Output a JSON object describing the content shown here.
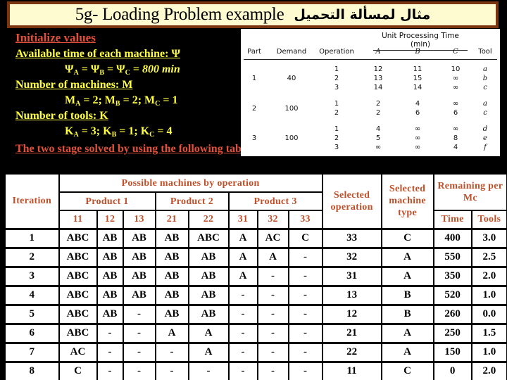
{
  "title": {
    "english": "5g- Loading Problem example",
    "arabic": "مثال لمسألة التحميل"
  },
  "intro": {
    "heading": "Initialize values",
    "available_time_label": "Available time of each machine: Ψ",
    "available_time_eq": {
      "symbol": "Ψ",
      "machines": [
        "A",
        "B",
        "C"
      ],
      "value": "800 min"
    },
    "num_machines_label": "Number of machines: M",
    "num_machines_eq": [
      {
        "symbol": "M",
        "sub": "A",
        "value": "2"
      },
      {
        "symbol": "M",
        "sub": "B",
        "value": "2"
      },
      {
        "symbol": "M",
        "sub": "C",
        "value": "1"
      }
    ],
    "num_tools_label": "Number of tools: K",
    "num_tools_eq": [
      {
        "symbol": "K",
        "sub": "A",
        "value": "3"
      },
      {
        "symbol": "K",
        "sub": "B",
        "value": "1"
      },
      {
        "symbol": "K",
        "sub": "C",
        "value": "4"
      }
    ],
    "stage_text": "The two stage solved by using the following table:"
  },
  "reference_table": {
    "caption": "Unit Processing Time (min)",
    "headers": [
      "Part",
      "Demand",
      "Operation",
      "A",
      "B",
      "C",
      "Tool"
    ],
    "parts": [
      {
        "part": "1",
        "demand": "40",
        "ops": [
          {
            "op": "1",
            "A": "12",
            "B": "11",
            "C": "10",
            "tool": "a"
          },
          {
            "op": "2",
            "A": "13",
            "B": "15",
            "C": "∞",
            "tool": "b"
          },
          {
            "op": "3",
            "A": "14",
            "B": "14",
            "C": "∞",
            "tool": "c"
          }
        ]
      },
      {
        "part": "2",
        "demand": "100",
        "ops": [
          {
            "op": "1",
            "A": "2",
            "B": "4",
            "C": "∞",
            "tool": "a"
          },
          {
            "op": "2",
            "A": "2",
            "B": "6",
            "C": "6",
            "tool": "c"
          }
        ]
      },
      {
        "part": "3",
        "demand": "100",
        "ops": [
          {
            "op": "1",
            "A": "4",
            "B": "∞",
            "C": "∞",
            "tool": "d"
          },
          {
            "op": "2",
            "A": "5",
            "B": "∞",
            "C": "8",
            "tool": "e"
          },
          {
            "op": "3",
            "A": "∞",
            "B": "∞",
            "C": "4",
            "tool": "f"
          }
        ]
      }
    ]
  },
  "main_table": {
    "headers": {
      "iteration": "Iteration",
      "possible": "Possible machines by operation",
      "products": [
        "Product 1",
        "Product 2",
        "Product 3"
      ],
      "operations": [
        "11",
        "12",
        "13",
        "21",
        "22",
        "31",
        "32",
        "33"
      ],
      "selected_operation": "Selected operation",
      "selected_machine": "Selected machine type",
      "remaining": "Remaining per Mc",
      "time": "Time",
      "tools": "Tools"
    },
    "rows": [
      {
        "iter": "1",
        "ops": [
          "ABC",
          "AB",
          "AB",
          "AB",
          "ABC",
          "A",
          "AC",
          "C"
        ],
        "sel_op": "33",
        "sel_mc": "C",
        "time": "400",
        "tools": "3.0"
      },
      {
        "iter": "2",
        "ops": [
          "ABC",
          "AB",
          "AB",
          "AB",
          "AB",
          "A",
          "A",
          "-"
        ],
        "sel_op": "32",
        "sel_mc": "A",
        "time": "550",
        "tools": "2.5"
      },
      {
        "iter": "3",
        "ops": [
          "ABC",
          "AB",
          "AB",
          "AB",
          "AB",
          "A",
          "-",
          "-"
        ],
        "sel_op": "31",
        "sel_mc": "A",
        "time": "350",
        "tools": "2.0"
      },
      {
        "iter": "4",
        "ops": [
          "ABC",
          "AB",
          "AB",
          "AB",
          "AB",
          "-",
          "-",
          "-"
        ],
        "sel_op": "13",
        "sel_mc": "B",
        "time": "520",
        "tools": "1.0"
      },
      {
        "iter": "5",
        "ops": [
          "ABC",
          "AB",
          "-",
          "AB",
          "AB",
          "-",
          "-",
          "-"
        ],
        "sel_op": "12",
        "sel_mc": "B",
        "time": "260",
        "tools": "0.0"
      },
      {
        "iter": "6",
        "ops": [
          "ABC",
          "-",
          "-",
          "A",
          "A",
          "-",
          "-",
          "-"
        ],
        "sel_op": "21",
        "sel_mc": "A",
        "time": "250",
        "tools": "1.5"
      },
      {
        "iter": "7",
        "ops": [
          "AC",
          "-",
          "-",
          "-",
          "A",
          "-",
          "-",
          "-"
        ],
        "sel_op": "22",
        "sel_mc": "A",
        "time": "150",
        "tools": "1.0"
      },
      {
        "iter": "8",
        "ops": [
          "C",
          "-",
          "-",
          "-",
          "-",
          "-",
          "-",
          "-"
        ],
        "sel_op": "11",
        "sel_mc": "C",
        "time": "0",
        "tools": "2.0"
      }
    ]
  },
  "colors": {
    "title_bg": "#fffbd0",
    "title_border": "#7a3410",
    "heading_red": "#e0503a",
    "text_yellow": "#ffff40",
    "table_header": "#c0502a"
  }
}
